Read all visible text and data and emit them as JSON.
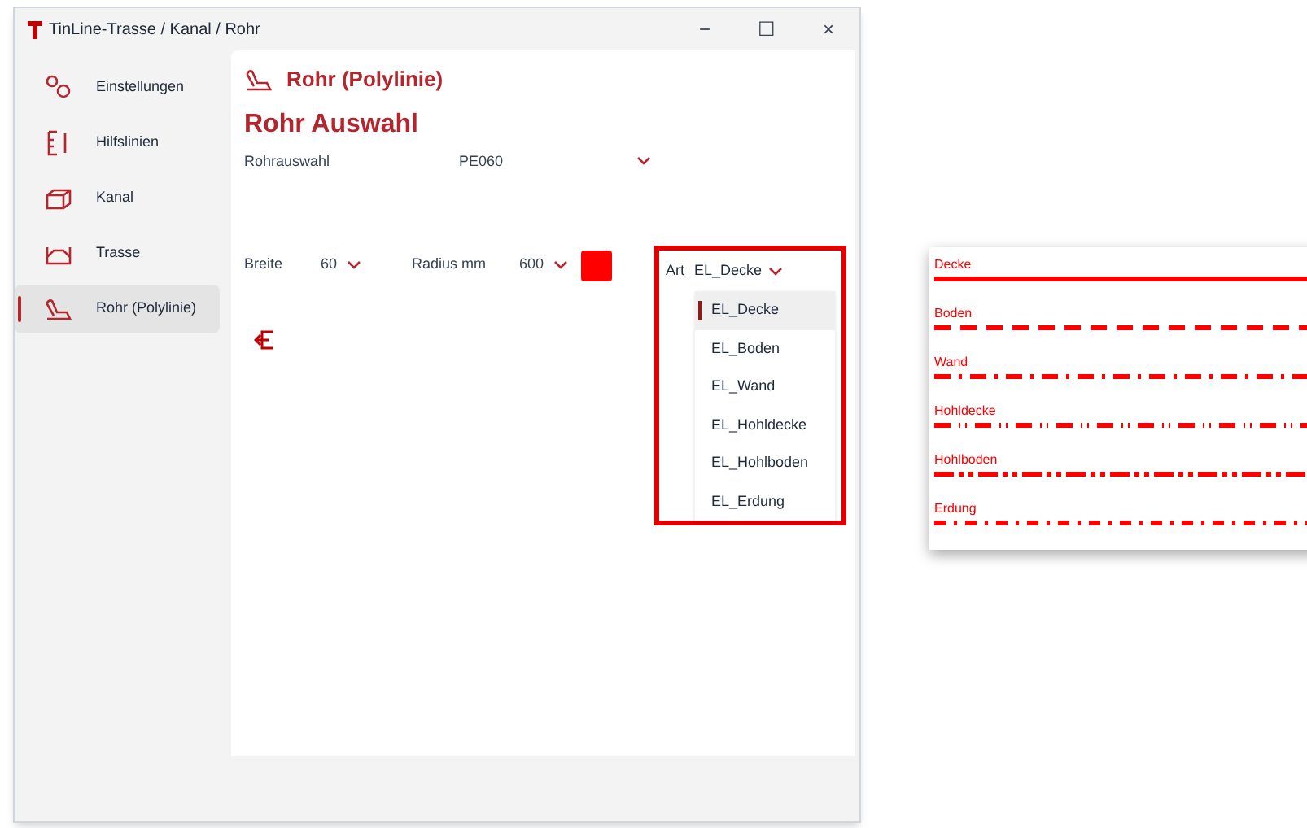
{
  "window": {
    "title": "TinLine-Trasse / Kanal / Rohr",
    "controls": [
      "−",
      "☐",
      "×"
    ]
  },
  "sidebar": {
    "items": [
      {
        "label": "Einstellungen",
        "selected": false
      },
      {
        "label": "Hilfslinien",
        "selected": false
      },
      {
        "label": "Kanal",
        "selected": false
      },
      {
        "label": "Trasse",
        "selected": false
      },
      {
        "label": "Rohr (Polylinie)",
        "selected": true
      }
    ]
  },
  "page": {
    "title": "Rohr (Polylinie)",
    "section": "Rohr Auswahl",
    "pipe_select": {
      "label": "Rohrauswahl",
      "value": "PE060"
    },
    "width": {
      "label": "Breite",
      "value": "60"
    },
    "radius": {
      "label": "Radius mm",
      "value": "600"
    },
    "color": "#ff0000",
    "type": {
      "label": "Art",
      "value": "EL_Decke",
      "options": [
        {
          "label": "EL_Decke",
          "selected": true
        },
        {
          "label": "EL_Boden",
          "selected": false
        },
        {
          "label": "EL_Wand",
          "selected": false
        },
        {
          "label": "EL_Hohldecke",
          "selected": false
        },
        {
          "label": "EL_Hohlboden",
          "selected": false
        },
        {
          "label": "EL_Erdung",
          "selected": false
        }
      ]
    }
  },
  "legend": [
    {
      "label": "Decke",
      "kind": "solid"
    },
    {
      "label": "Boden",
      "kind": "dash"
    },
    {
      "label": "Wand",
      "kind": "dashdot"
    },
    {
      "label": "Hohldecke",
      "kind": "dashdotdot"
    },
    {
      "label": "Hohlboden",
      "kind": "longshort"
    },
    {
      "label": "Erdung",
      "kind": "shortdot"
    }
  ]
}
